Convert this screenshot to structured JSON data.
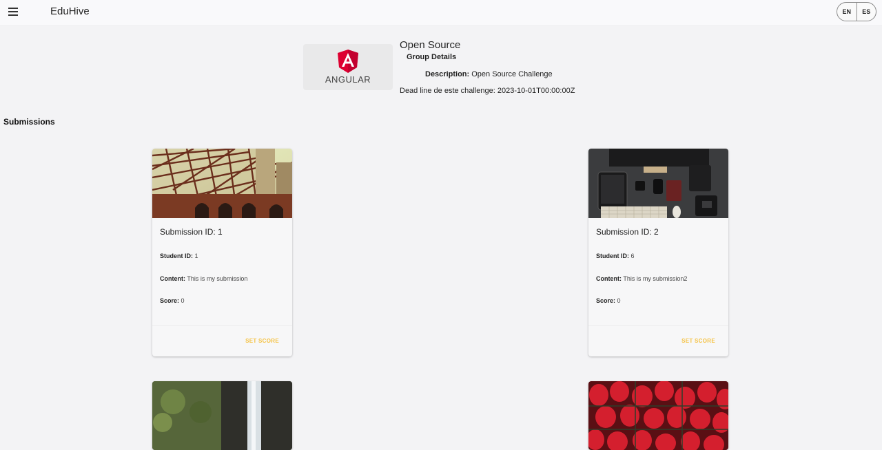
{
  "app": {
    "title": "EduHive",
    "lang_en": "EN",
    "lang_es": "ES"
  },
  "challenge": {
    "logo_text": "ANGULAR",
    "title": "Open Source",
    "group_details": "Group Details",
    "description_label": "Description:",
    "description": "Open Source Challenge",
    "deadline_label": "Dead line de este challenge:",
    "deadline": "2023-10-01T00:00:00Z"
  },
  "submissions_heading": "Submissions",
  "labels": {
    "student_id": "Student ID:",
    "content": "Content:",
    "score": "Score:",
    "set_score": "SET SCORE"
  },
  "submissions": [
    {
      "title": "Submission ID: 1",
      "student_id": "1",
      "content": "This is my submission",
      "score": "0",
      "image": "bridge-photo"
    },
    {
      "title": "Submission ID: 2",
      "student_id": "6",
      "content": "This is my submission2",
      "score": "0",
      "image": "desk-photo"
    },
    {
      "image": "waterfall-photo"
    },
    {
      "image": "strawberries-photo"
    }
  ]
}
